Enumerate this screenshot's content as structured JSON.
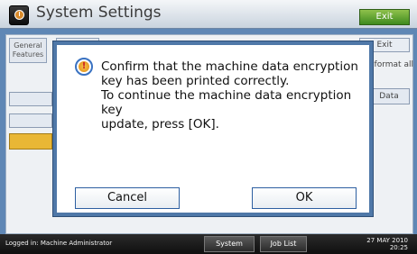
{
  "titlebar": {
    "title": "System Settings",
    "exit_label": "Exit"
  },
  "background": {
    "tabs": [
      {
        "label": "General Features"
      },
      {
        "label": ""
      }
    ],
    "exit_label": "Exit",
    "format_text": "r format all",
    "data_label": "Data"
  },
  "dialog": {
    "icon": "info-warning-icon",
    "message": "Confirm that the machine data encryption\nkey has been printed correctly.\nTo continue the machine data encryption key\nupdate, press [OK].",
    "cancel_label": "Cancel",
    "ok_label": "OK"
  },
  "footer": {
    "login_text": "Logged in: Machine Administrator",
    "system_status_label": "System Status",
    "job_list_label": "Job List",
    "date": "27 MAY  2010",
    "time": "20:25"
  },
  "colors": {
    "accent_blue": "#4f78a8",
    "exit_green": "#3f8a1f",
    "highlight_yellow": "#e9b735",
    "footer_bg": "#0f0f0f"
  }
}
